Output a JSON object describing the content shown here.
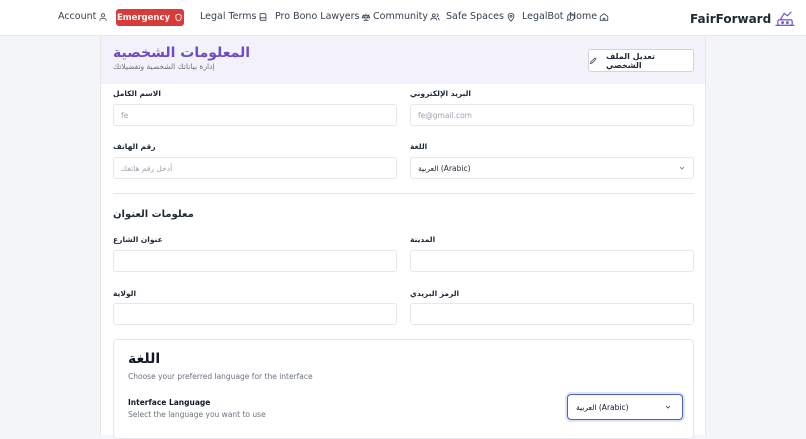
{
  "nav": {
    "account": "Account",
    "emergency": "Emergency",
    "legal_terms": "Legal Terms",
    "pro_bono": "Pro Bono Lawyers",
    "community": "Community",
    "safe_spaces": "Safe Spaces",
    "legalbot": "LegalBot",
    "home": "Home",
    "brand": "FairForward"
  },
  "profile": {
    "title": "المعلومات الشخصية",
    "subtitle": "إدارة بياناتك الشخصية وتفضيلاتك",
    "edit_button": "تعديل الملف الشخصي",
    "full_name_label": "الاسم الكامل",
    "full_name_value": "fe",
    "email_label": "البريد الإلكتروني",
    "email_value": "fe@gmail.com",
    "phone_label": "رقم الهاتف",
    "phone_placeholder": "أدخل رقم هاتفك",
    "language_label": "اللغة",
    "language_value": "العربية (Arabic)"
  },
  "address": {
    "section_title": "معلومات العنوان",
    "street_label": "عنوان الشارع",
    "city_label": "المدينة",
    "state_label": "الولاية",
    "postal_label": "الرمز البريدي"
  },
  "language_settings": {
    "title": "اللغة",
    "description": "Choose your preferred language for the interface",
    "interface_label": "Interface Language",
    "interface_hint": "Select the language you want to use",
    "selected": "العربية (Arabic)"
  },
  "colors": {
    "emergency": "#d93a3a",
    "title_accent": "#6d4bc9",
    "focus_ring": "#4a5fc1"
  },
  "icons": [
    "user-icon",
    "shield-icon",
    "book-icon",
    "scale-icon",
    "users-icon",
    "map-pin-icon",
    "chat-icon",
    "home-icon",
    "pencil-icon",
    "chevron-down-icon",
    "logo-icon"
  ]
}
